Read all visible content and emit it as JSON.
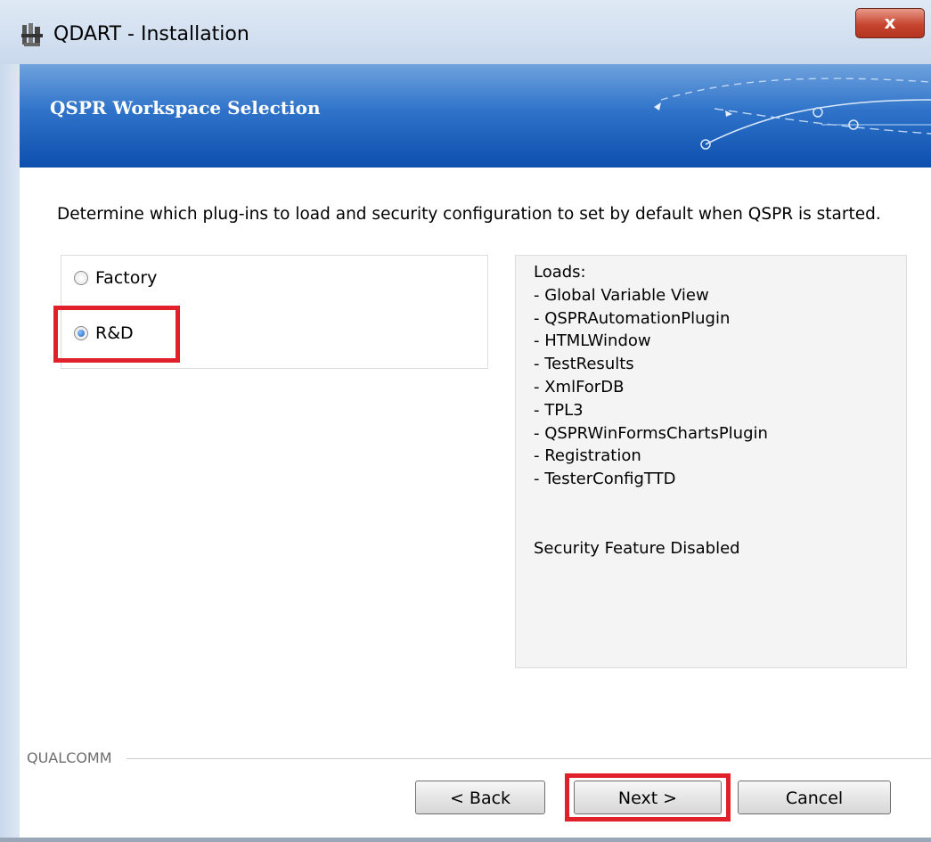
{
  "window": {
    "title": "QDART - Installation",
    "close_label": "x"
  },
  "banner": {
    "title": "QSPR Workspace Selection"
  },
  "description": "Determine which plug-ins to load and security configuration to set by default when QSPR is started.",
  "workspace_options": [
    {
      "label": "Factory",
      "selected": false
    },
    {
      "label": "R&D",
      "selected": true
    }
  ],
  "info": {
    "heading": "Loads:",
    "items": [
      "- Global Variable View",
      "- QSPRAutomationPlugin",
      "- HTMLWindow",
      "- TestResults",
      "- XmlForDB",
      "- TPL3",
      "- QSPRWinFormsChartsPlugin",
      "- Registration",
      "- TesterConfigTTD"
    ],
    "security": "Security Feature Disabled"
  },
  "brand": "QUALCOMM",
  "buttons": {
    "back": "< Back",
    "next": "Next >",
    "cancel": "Cancel"
  },
  "colors": {
    "highlight": "#e0202a",
    "banner_dark": "#0d4fae",
    "banner_light": "#6fa2dd"
  }
}
